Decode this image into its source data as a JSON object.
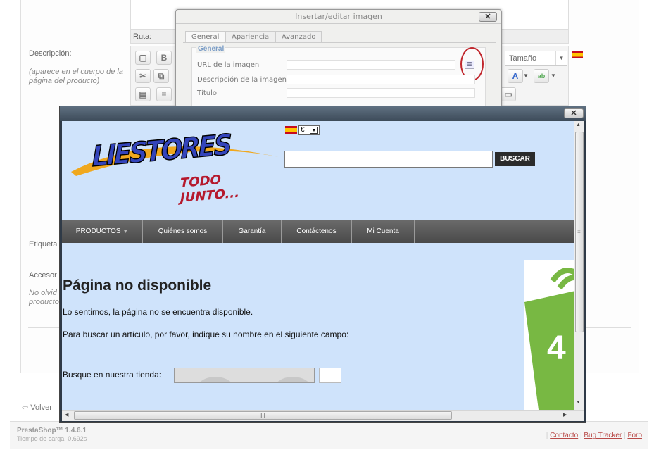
{
  "background": {
    "ruta_label": "Ruta:",
    "descripcion_label": "Descripción:",
    "descripcion_hint": "(aparece en el cuerpo de la página del producto)",
    "etiquetas_label": "Etiqueta",
    "accesorios_label": "Accesor",
    "accesorios_hint": "No olvid producto",
    "tamano_select": "Tamaño",
    "volver_link": "Volver",
    "toolbar_b": "B",
    "toolbar_a": "A"
  },
  "footer": {
    "version": "PrestaShop™ 1.4.6.1",
    "load_time": "Tiempo de carga: 0.692s",
    "links": [
      "Contacto",
      "Bug Tracker",
      "Foro"
    ]
  },
  "image_dialog": {
    "title": "Insertar/editar imagen",
    "tabs": [
      "General",
      "Apariencia",
      "Avanzado"
    ],
    "legend": "General",
    "fields": [
      "URL de la imagen",
      "Descripción de la imagen",
      "Título"
    ]
  },
  "preview": {
    "currency": "€",
    "logo_main": "LIESTORES",
    "logo_sub": "TODO JUNTO...",
    "search_button": "BUSCAR",
    "search_value": "",
    "nav": [
      "PRODUCTOS",
      "Quiénes somos",
      "Garantía",
      "Contáctenos",
      "Mi Cuenta"
    ],
    "heading": "Página no disponible",
    "message": "Lo sentimos, la página no se encuentra disponible.",
    "instruction": "Para buscar un artículo, por favor, indique su nombre en el siguiente campo:",
    "search_store_label": "Busque en nuestra tienda:",
    "promo_text": "4",
    "scroll_grip": "III"
  },
  "colors": {
    "accent_red": "#c1272d",
    "preview_bg": "#cfe3fb",
    "link": "#b94a48"
  }
}
